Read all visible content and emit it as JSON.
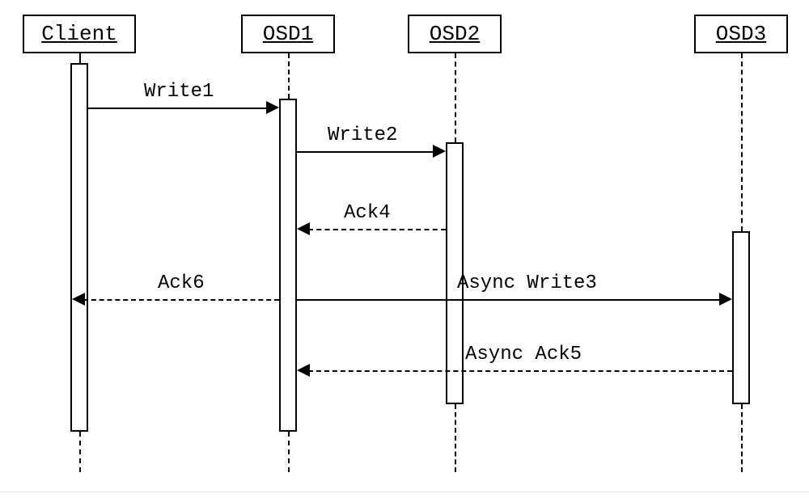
{
  "participants": {
    "client": "Client",
    "osd1": "OSD1",
    "osd2": "OSD2",
    "osd3": "OSD3"
  },
  "messages": {
    "write1": "Write1",
    "write2": "Write2",
    "ack4": "Ack4",
    "async_write3": "Async Write3",
    "ack6": "Ack6",
    "async_ack5": "Async Ack5"
  },
  "chart_data": {
    "type": "sequence-diagram",
    "participants": [
      "Client",
      "OSD1",
      "OSD2",
      "OSD3"
    ],
    "steps": [
      {
        "n": 1,
        "from": "Client",
        "to": "OSD1",
        "label": "Write1",
        "style": "solid",
        "kind": "sync-call"
      },
      {
        "n": 2,
        "from": "OSD1",
        "to": "OSD2",
        "label": "Write2",
        "style": "solid",
        "kind": "sync-call"
      },
      {
        "n": 3,
        "from": "OSD2",
        "to": "OSD1",
        "label": "Ack4",
        "style": "dashed",
        "kind": "reply"
      },
      {
        "n": 4,
        "from": "OSD1",
        "to": "OSD3",
        "label": "Async Write3",
        "style": "solid",
        "kind": "async-call"
      },
      {
        "n": 5,
        "from": "OSD1",
        "to": "Client",
        "label": "Ack6",
        "style": "dashed",
        "kind": "reply"
      },
      {
        "n": 6,
        "from": "OSD3",
        "to": "OSD1",
        "label": "Async Ack5",
        "style": "dashed",
        "kind": "reply"
      }
    ]
  }
}
